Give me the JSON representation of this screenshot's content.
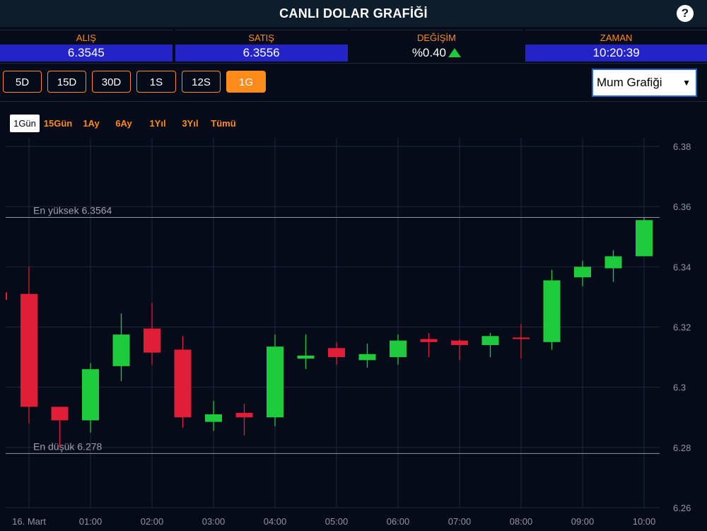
{
  "header": {
    "title": "CANLI DOLAR GRAFİĞİ",
    "help": "?"
  },
  "ticker": [
    {
      "label": "ALIŞ",
      "value": "6.3545"
    },
    {
      "label": "SATIŞ",
      "value": "6.3556"
    },
    {
      "label": "DEĞİŞİM",
      "value": "%0.40"
    },
    {
      "label": "ZAMAN",
      "value": "10:20:39"
    }
  ],
  "range_buttons": [
    "5D",
    "15D",
    "30D",
    "1S",
    "12S",
    "1G"
  ],
  "active_range": "1G",
  "chart_type_select": {
    "selected": "Mum Grafiği"
  },
  "period_buttons": [
    "1Gün",
    "15Gün",
    "1Ay",
    "6Ay",
    "1Yıl",
    "3Yıl",
    "Tümü"
  ],
  "active_period": "1Gün",
  "colors": {
    "up": "#1ecb3c",
    "down": "#e01e37",
    "accent": "#ff8c1a",
    "value_bg": "#2323c8"
  },
  "chart_data": {
    "type": "candlestick",
    "x_ticks": [
      "16. Mart",
      "01:00",
      "02:00",
      "03:00",
      "04:00",
      "05:00",
      "06:00",
      "07:00",
      "08:00",
      "09:00",
      "10:00"
    ],
    "y_ticks": [
      "6.38",
      "6.36",
      "6.34",
      "6.32",
      "6.3",
      "6.28",
      "6.26"
    ],
    "ylim": [
      6.26,
      6.38
    ],
    "reference_lines": [
      {
        "label": "En yüksek 6.3564",
        "value": 6.3564
      },
      {
        "label": "En düşük 6.278",
        "value": 6.278
      }
    ],
    "candles": [
      {
        "time": "00:00",
        "open": 6.331,
        "high": 6.34,
        "low": 6.288,
        "close": 6.2935
      },
      {
        "time": "00:30",
        "open": 6.2935,
        "high": 6.2935,
        "low": 6.28,
        "close": 6.289
      },
      {
        "time": "01:00",
        "open": 6.289,
        "high": 6.308,
        "low": 6.285,
        "close": 6.306
      },
      {
        "time": "01:30",
        "open": 6.307,
        "high": 6.3245,
        "low": 6.302,
        "close": 6.3175
      },
      {
        "time": "02:00",
        "open": 6.3195,
        "high": 6.328,
        "low": 6.3075,
        "close": 6.3115
      },
      {
        "time": "02:30",
        "open": 6.3125,
        "high": 6.317,
        "low": 6.2865,
        "close": 6.29
      },
      {
        "time": "03:00",
        "open": 6.2885,
        "high": 6.2955,
        "low": 6.2855,
        "close": 6.291
      },
      {
        "time": "03:30",
        "open": 6.2915,
        "high": 6.2945,
        "low": 6.284,
        "close": 6.29
      },
      {
        "time": "04:00",
        "open": 6.29,
        "high": 6.3175,
        "low": 6.287,
        "close": 6.3135
      },
      {
        "time": "04:30",
        "open": 6.3095,
        "high": 6.3175,
        "low": 6.306,
        "close": 6.3105
      },
      {
        "time": "05:00",
        "open": 6.313,
        "high": 6.315,
        "low": 6.3075,
        "close": 6.31
      },
      {
        "time": "05:30",
        "open": 6.309,
        "high": 6.3145,
        "low": 6.3065,
        "close": 6.311
      },
      {
        "time": "06:00",
        "open": 6.31,
        "high": 6.3175,
        "low": 6.3075,
        "close": 6.3155
      },
      {
        "time": "06:30",
        "open": 6.316,
        "high": 6.318,
        "low": 6.31,
        "close": 6.315
      },
      {
        "time": "07:00",
        "open": 6.3155,
        "high": 6.316,
        "low": 6.309,
        "close": 6.314
      },
      {
        "time": "07:30",
        "open": 6.314,
        "high": 6.318,
        "low": 6.31,
        "close": 6.317
      },
      {
        "time": "08:00",
        "open": 6.3165,
        "high": 6.321,
        "low": 6.3095,
        "close": 6.316
      },
      {
        "time": "08:30",
        "open": 6.315,
        "high": 6.339,
        "low": 6.3125,
        "close": 6.3355
      },
      {
        "time": "09:00",
        "open": 6.3365,
        "high": 6.342,
        "low": 6.3335,
        "close": 6.34
      },
      {
        "time": "09:30",
        "open": 6.3395,
        "high": 6.3455,
        "low": 6.335,
        "close": 6.3435
      },
      {
        "time": "10:00",
        "open": 6.3435,
        "high": 6.3564,
        "low": 6.3435,
        "close": 6.3555
      }
    ]
  }
}
